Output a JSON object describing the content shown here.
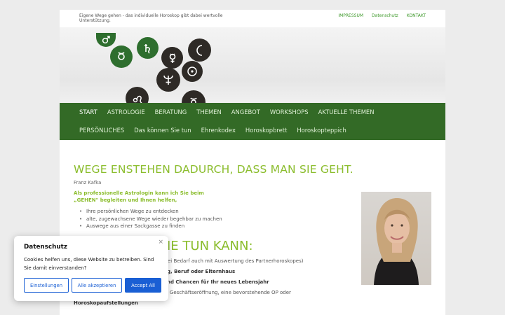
{
  "header": {
    "tagline": "Eigene Wege gehen - das individuelle Horoskop gibt dabei wertvolle Unterstützung.",
    "links": [
      {
        "label": "IMPRESSUM"
      },
      {
        "label": "Datenschutz"
      },
      {
        "label": "KONTAKT"
      }
    ]
  },
  "nav": {
    "row1": [
      "START",
      "ASTROLOGIE",
      "BERATUNG",
      "THEMEN",
      "ANGEBOT",
      "WORKSHOPS",
      "AKTUELLE THEMEN"
    ],
    "row2": [
      "PERSÖNLICHES",
      "Das können Sie tun",
      "Ehrenkodex",
      "Horoskopbrett",
      "Horoskopteppich"
    ]
  },
  "main": {
    "heading": "WEGE ENSTEHEN DADURCH, DASS MAN SIE GEHT.",
    "quote_author": "Franz Kafka",
    "intro": "Als professionelle Astrologin kann ich Sie beim „GEHEN\" begleiten und Ihnen helfen,",
    "bullets": [
      "Ihre persönlichen Wege zu entdecken",
      "alte, zugewachsene Wege wieder begehbar zu machen",
      "Auswege aus einer Sackgasse zu finden"
    ],
    "subheading_visible": "IE TUN KANN:",
    "offers": [
      {
        "text": "ei Bedarf auch mit Auswertung des Partnerhoroskopes)",
        "bold": false
      },
      {
        "text": "ng, Beruf oder Elternhaus",
        "bold": true
      },
      {
        "text": "und Chancen für Ihr neues Lebensjahr",
        "bold": true
      },
      {
        "text": "3. Geschäftseröffnung, eine bevorstehende OP oder",
        "bold": false
      },
      {
        "text": "Horoskopaufstellungen",
        "bold": true
      }
    ]
  },
  "cookie": {
    "title": "Datenschutz",
    "text": "Cookies helfen uns, diese Website zu betreiben. Sind Sie damit einverstanden?",
    "close": "×",
    "buttons": {
      "settings": "Einstellungen",
      "accept_all": "Alle akzeptieren",
      "accept_all_en": "Accept All"
    }
  },
  "colors": {
    "nav_bg": "#336a26",
    "accent_green": "#8bbd2d",
    "link_green": "#3f9a2c",
    "cookie_blue": "#1a5fd4"
  },
  "icons": [
    "mars-icon",
    "saturn-icon",
    "moon-icon",
    "venus-icon",
    "sun-icon",
    "neptune-icon",
    "leo-icon",
    "mercury-icon"
  ]
}
